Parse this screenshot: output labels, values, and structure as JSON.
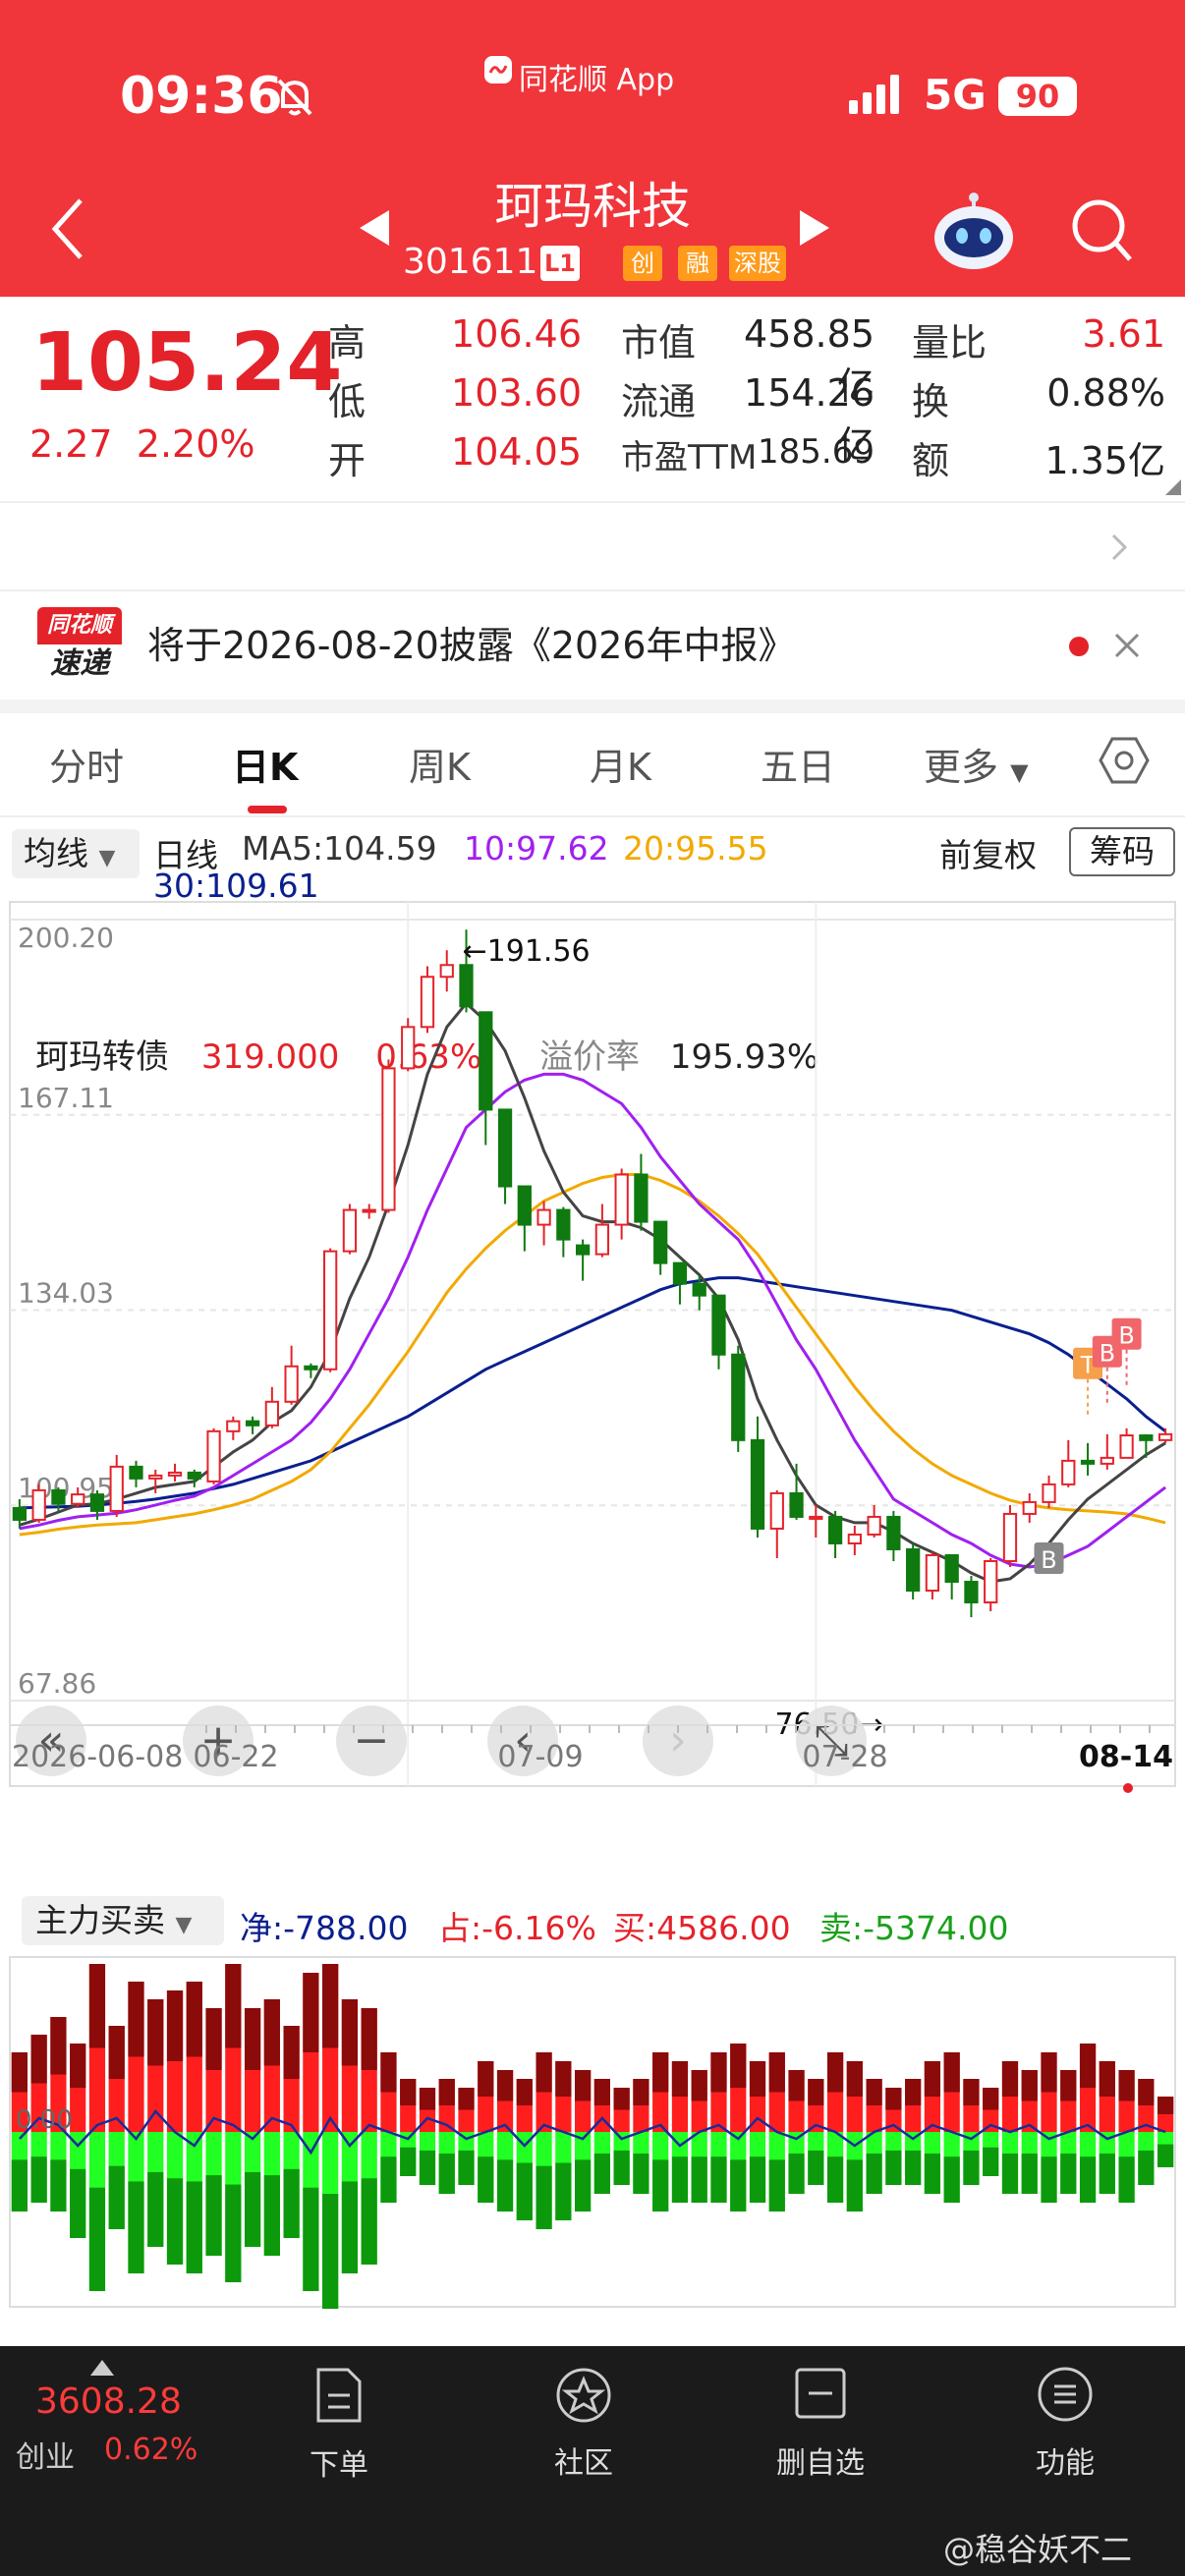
{
  "status_bar": {
    "time": "09:36",
    "app_badge": "同花顺 App",
    "network": "5G",
    "battery": "90"
  },
  "header": {
    "stock_name": "珂玛科技",
    "code": "301611",
    "level": "L1",
    "tags": [
      "创",
      "融",
      "深股"
    ]
  },
  "quote": {
    "price": "105.24",
    "change": "2.27",
    "change_pct": "2.20%",
    "fields": [
      {
        "label": "高",
        "value": "106.46",
        "tone": "red"
      },
      {
        "label": "低",
        "value": "103.60",
        "tone": "red"
      },
      {
        "label": "开",
        "value": "104.05",
        "tone": "red"
      },
      {
        "label": "市值",
        "value": "458.85亿",
        "tone": "dark"
      },
      {
        "label": "流通",
        "value": "154.26亿",
        "tone": "dark"
      },
      {
        "label": "市盈TTM",
        "value": "185.69",
        "tone": "dark"
      },
      {
        "label": "量比",
        "value": "3.61",
        "tone": "red"
      },
      {
        "label": "换",
        "value": "0.88%",
        "tone": "dark"
      },
      {
        "label": "额",
        "value": "1.35亿",
        "tone": "dark"
      }
    ]
  },
  "convertible": {
    "name": "珂玛转债",
    "price": "319.000",
    "pct": "0.63%",
    "premium_label": "溢价率",
    "premium": "195.93%"
  },
  "notice": {
    "logo_top": "同花顺",
    "logo_bottom": "速递",
    "text": "将于2026-08-20披露《2026年中报》"
  },
  "tabs": [
    "分时",
    "日K",
    "周K",
    "月K",
    "五日",
    "更多"
  ],
  "active_tab": 1,
  "ma_bar": {
    "selector": "均线",
    "period": "日线",
    "ma5": "MA5:104.59",
    "ma10": "10:97.62",
    "ma20": "20:95.55",
    "ma30": "30:109.61",
    "adjust": "前复权",
    "chips": "筹码"
  },
  "colors": {
    "up": "#e4222a",
    "down": "#0f7a0f",
    "ma5": "#444444",
    "ma10": "#a020f0",
    "ma20": "#f2a900",
    "ma30": "#0a1f8f"
  },
  "chart_data": [
    {
      "type": "candlestick",
      "yticks": [
        "200.20",
        "167.11",
        "134.03",
        "100.95",
        "67.86"
      ],
      "ylim": [
        67.86,
        200.2
      ],
      "xticks": [
        "2026-06-08",
        "06-22",
        "07-09",
        "07-28",
        "08-14"
      ],
      "high_label": "←191.56",
      "low_label": "76.50→",
      "markers": [
        "T",
        "B",
        "B",
        "B"
      ],
      "candles": [
        [
          100.5,
          98.5,
          102,
          97
        ],
        [
          98.5,
          103.5,
          104.5,
          98
        ],
        [
          103.5,
          101.2,
          104,
          100
        ],
        [
          101.2,
          102.8,
          104,
          100.5
        ],
        [
          102.8,
          100,
          103.5,
          98.5
        ],
        [
          100,
          107.5,
          109.5,
          99
        ],
        [
          107.5,
          105.5,
          108.5,
          104
        ],
        [
          105.5,
          106,
          107,
          103
        ],
        [
          106,
          106.5,
          108,
          105
        ],
        [
          106.5,
          105.5,
          107,
          104
        ],
        [
          105,
          113.5,
          114,
          104.5
        ],
        [
          113.5,
          115.2,
          116,
          112
        ],
        [
          115.2,
          114.5,
          116,
          113
        ],
        [
          114.5,
          118.5,
          121,
          114
        ],
        [
          118.5,
          124.5,
          128,
          118
        ],
        [
          124.5,
          124,
          125,
          122.5
        ],
        [
          124,
          144,
          144.5,
          123.5
        ],
        [
          144,
          151,
          152,
          143.5
        ],
        [
          151,
          151,
          152,
          149.5
        ],
        [
          151,
          175,
          176.5,
          150.5
        ],
        [
          175,
          182,
          183.5,
          174.5
        ],
        [
          182,
          190.5,
          192.3,
          181
        ],
        [
          190.5,
          192.5,
          195,
          188
        ],
        [
          192.5,
          185.5,
          198.5,
          184.5
        ],
        [
          184.5,
          168,
          172,
          162
        ],
        [
          168,
          155,
          156.5,
          152
        ],
        [
          155,
          148.5,
          154,
          144
        ],
        [
          148.5,
          151,
          152.5,
          145
        ],
        [
          151,
          146,
          151.5,
          143
        ],
        [
          145,
          143.5,
          146,
          139
        ],
        [
          143.5,
          148.5,
          152,
          143
        ],
        [
          148.5,
          157,
          158,
          146
        ],
        [
          157,
          149,
          160.5,
          147.5
        ],
        [
          149,
          142,
          148,
          140
        ],
        [
          142,
          138.5,
          142,
          135
        ],
        [
          138.5,
          136.5,
          140,
          134
        ],
        [
          136.5,
          126.5,
          136.5,
          124
        ],
        [
          126.5,
          112,
          128,
          110
        ],
        [
          112,
          97,
          116,
          95.5
        ],
        [
          97,
          103,
          103.5,
          92
        ],
        [
          103,
          99,
          108,
          98.5
        ],
        [
          99,
          99,
          101,
          95.5
        ],
        [
          99,
          94.5,
          100,
          92
        ],
        [
          94.5,
          96,
          97.5,
          92.5
        ],
        [
          96,
          99,
          101,
          95.5
        ],
        [
          99,
          93.5,
          100,
          91.5
        ],
        [
          93.5,
          86.5,
          94.5,
          85
        ],
        [
          86.5,
          92.5,
          93,
          85
        ],
        [
          92.5,
          88,
          92.5,
          85
        ],
        [
          88,
          84.5,
          89,
          82
        ],
        [
          84.5,
          91.5,
          92,
          83
        ],
        [
          91.5,
          99.5,
          101,
          90.5
        ],
        [
          99.5,
          101.5,
          103,
          98
        ],
        [
          101.5,
          104.5,
          106,
          100.5
        ],
        [
          104.5,
          108.5,
          112,
          104
        ],
        [
          108.5,
          108,
          111.5,
          106
        ],
        [
          108,
          109,
          113,
          107
        ],
        [
          109,
          112.8,
          114,
          109
        ],
        [
          112.8,
          112,
          113,
          109
        ],
        [
          112,
          113,
          114,
          111.5
        ]
      ],
      "ma5": [
        97.6,
        98.6,
        99.8,
        101,
        101.2,
        102,
        103,
        104,
        104.5,
        105,
        107.5,
        110,
        112,
        115,
        117,
        121,
        127,
        136,
        143,
        152,
        162,
        174,
        182,
        186,
        183,
        178,
        170,
        161,
        154,
        150,
        149,
        149,
        148,
        146,
        143,
        140,
        136,
        129,
        119,
        112,
        106,
        101,
        99,
        98,
        98,
        96.5,
        94.5,
        93,
        91.5,
        89.5,
        88,
        88.5,
        91,
        94.5,
        98.5,
        102,
        104.5,
        107,
        109.5,
        111.5
      ],
      "ma10": [
        97,
        97.6,
        98.4,
        99,
        99.3,
        99.6,
        100.2,
        101,
        101.8,
        102.5,
        104,
        106,
        108,
        110,
        112,
        115,
        119,
        124,
        130,
        136,
        143,
        151,
        158,
        165,
        168,
        171,
        173,
        174,
        174,
        173,
        171,
        169,
        165,
        160,
        156,
        152,
        149,
        146,
        141,
        135,
        129,
        124,
        118,
        112,
        107,
        102,
        100,
        98,
        96,
        94.5,
        92.5,
        91,
        90.5,
        91,
        92.5,
        94,
        96.5,
        99,
        101.5,
        104
      ],
      "ma20": [
        96,
        96.4,
        96.9,
        97.3,
        97.6,
        97.8,
        98,
        98.5,
        99,
        99.5,
        100.2,
        101,
        102,
        103.5,
        105,
        107,
        110,
        114,
        118,
        122.5,
        127,
        132,
        137,
        141,
        144.5,
        147.5,
        150,
        152.5,
        154,
        155.5,
        156.5,
        157,
        157,
        156,
        154.5,
        152.5,
        150,
        147,
        143.5,
        139,
        134.5,
        130,
        125.5,
        121,
        117,
        113.5,
        110.5,
        108,
        106,
        104.5,
        103,
        101.8,
        101,
        100.5,
        100.2,
        100,
        99.8,
        99.5,
        98.8,
        98
      ],
      "ma30": [
        100.5,
        100.6,
        100.7,
        100.8,
        101,
        101.3,
        101.6,
        102,
        102.5,
        103,
        103.8,
        104.5,
        105.5,
        106.5,
        107.5,
        108.5,
        110,
        111.5,
        113,
        114.5,
        116,
        118,
        120,
        122,
        124,
        125.5,
        127,
        128.5,
        130,
        131.5,
        133,
        134.5,
        136,
        137.5,
        138.5,
        139,
        139.5,
        139.5,
        139,
        138.5,
        138,
        137.5,
        137,
        136.5,
        136,
        135.5,
        135,
        134.5,
        134,
        133,
        132,
        131,
        130,
        128.5,
        126.5,
        124,
        121.5,
        119,
        116,
        113.5
      ]
    },
    {
      "type": "bar",
      "title": "主力买卖",
      "net": "净:-788.00",
      "share": "占:-6.16%",
      "buy": "买:4586.00",
      "sell": "卖:-5374.00",
      "zero_label": "0.00",
      "buy_values": [
        45,
        55,
        65,
        50,
        95,
        60,
        85,
        75,
        80,
        85,
        70,
        95,
        70,
        75,
        60,
        90,
        95,
        75,
        70,
        45,
        30,
        25,
        30,
        25,
        40,
        35,
        30,
        45,
        40,
        35,
        30,
        25,
        30,
        45,
        40,
        35,
        45,
        50,
        40,
        45,
        35,
        30,
        45,
        40,
        30,
        25,
        30,
        40,
        45,
        30,
        25,
        40,
        35,
        45,
        35,
        50,
        40,
        35,
        30,
        20
      ],
      "sell_values": [
        -45,
        -40,
        -45,
        -60,
        -90,
        -55,
        -80,
        -65,
        -75,
        -80,
        -70,
        -85,
        -65,
        -70,
        -60,
        -90,
        -100,
        -80,
        -75,
        -40,
        -25,
        -30,
        -35,
        -30,
        -40,
        -45,
        -50,
        -55,
        -50,
        -45,
        -35,
        -30,
        -35,
        -45,
        -40,
        -40,
        -40,
        -45,
        -40,
        -45,
        -35,
        -30,
        -40,
        -45,
        -35,
        -30,
        -30,
        -35,
        -40,
        -30,
        -25,
        -35,
        -35,
        -40,
        -35,
        -40,
        -35,
        -40,
        -30,
        -20
      ],
      "net_line": [
        -5,
        10,
        5,
        -10,
        5,
        10,
        -5,
        15,
        0,
        -10,
        10,
        5,
        -5,
        10,
        5,
        -15,
        10,
        -10,
        5,
        0,
        -5,
        10,
        5,
        -5,
        0,
        5,
        -10,
        5,
        0,
        -5,
        10,
        -5,
        0,
        5,
        -10,
        0,
        5,
        -5,
        10,
        0,
        -5,
        5,
        0,
        -10,
        0,
        5,
        -5,
        5,
        0,
        -5,
        5,
        0,
        5,
        -5,
        0,
        5,
        -5,
        0,
        5,
        0
      ]
    }
  ],
  "chart_controls": {
    "zoom_in": "+",
    "zoom_out": "−"
  },
  "bottom_bar": {
    "index_value": "3608.28",
    "index_name": "创业",
    "index_pct": "0.62%",
    "items": [
      "下单",
      "社区",
      "删自选",
      "功能"
    ]
  },
  "watermark": "@稳谷妖不二"
}
